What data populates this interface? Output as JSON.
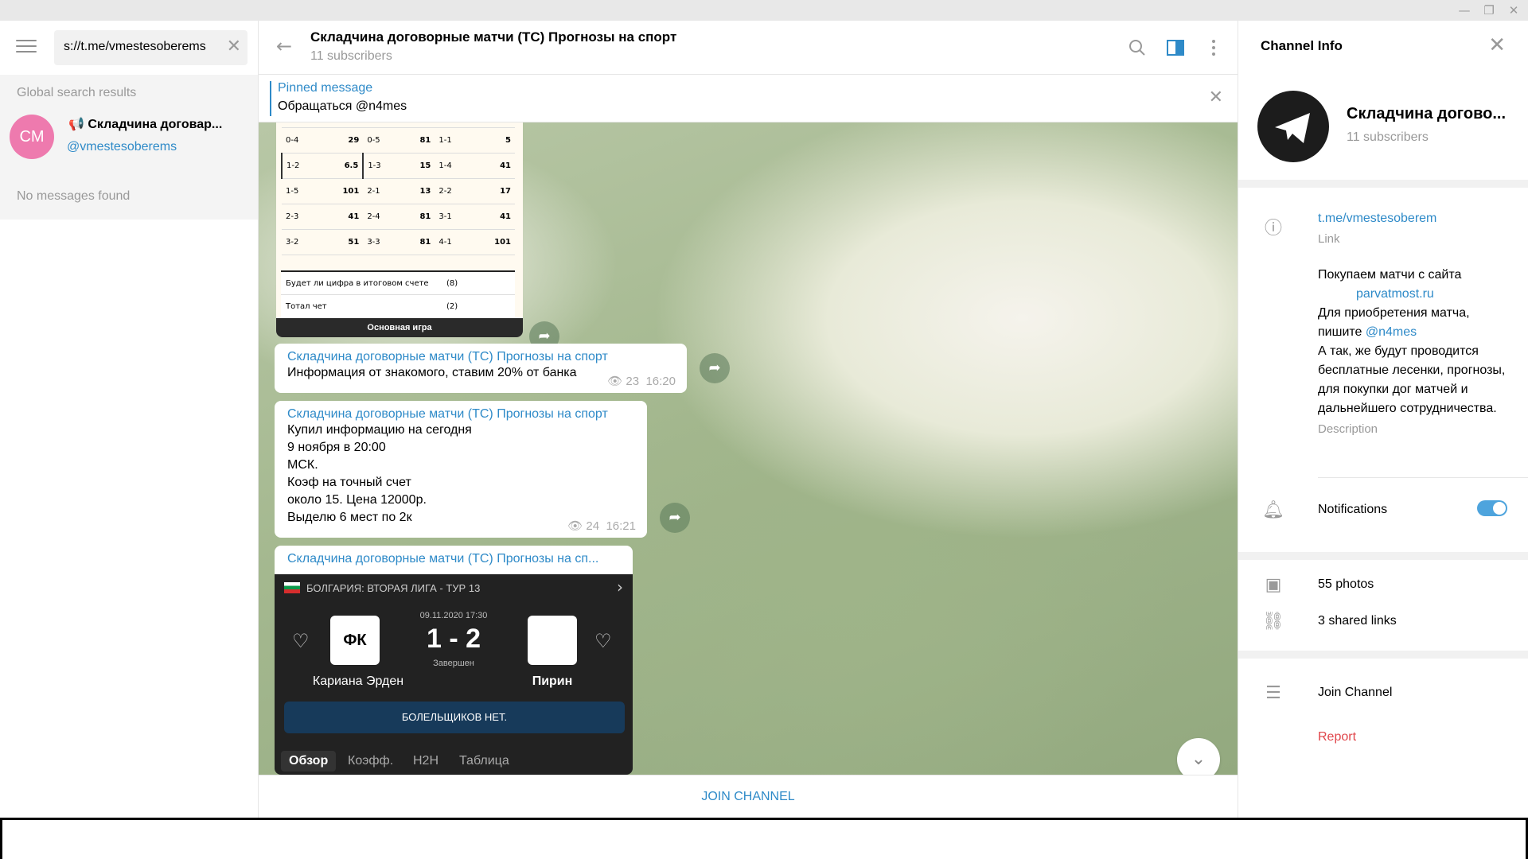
{
  "window": {
    "min": "—",
    "max": "❐",
    "close": "✕"
  },
  "left": {
    "search_value": "s://t.me/vmestesoberems",
    "global_search_header": "Global search results",
    "result": {
      "initials": "CM",
      "name": "📢 Складчина договар...",
      "handle": "@vmestesoberems"
    },
    "no_messages": "No messages found"
  },
  "chat": {
    "title": "Складчина договорные матчи (ТС) Прогнозы на спорт",
    "subscribers": "11 subscribers",
    "pinned_label": "Pinned message",
    "pinned_text": "Обращаться @n4mes",
    "join_label": "JOIN CHANNEL",
    "photo1": {
      "rows": [
        [
          "0-4",
          "29",
          "0-5",
          "81",
          "1-1",
          "5"
        ],
        [
          "1-2",
          "6.5",
          "1-3",
          "15",
          "1-4",
          "41"
        ],
        [
          "1-5",
          "101",
          "2-1",
          "13",
          "2-2",
          "17"
        ],
        [
          "2-3",
          "41",
          "2-4",
          "81",
          "3-1",
          "41"
        ],
        [
          "3-2",
          "51",
          "3-3",
          "81",
          "4-1",
          "101"
        ]
      ],
      "row_digit": "Будет ли цифра в итоговом счете",
      "row_digit_count": "(8)",
      "row_total": "Тотал чет",
      "row_total_count": "(2)",
      "footer": "Основная игра"
    },
    "messages": [
      {
        "author": "Складчина договорные матчи (ТС) Прогнозы на спорт",
        "text": "Информация от знакомого, ставим 20% от банка",
        "views": "23",
        "time": "16:20"
      },
      {
        "author": "Складчина договорные матчи (ТС) Прогнозы на спорт",
        "lines": [
          "Купил информацию на сегодня",
          "9 ноября в 20:00",
          "МСК.",
          "Коэф на точный счет",
          "около 15. Цена 12000р.",
          "Выделю 6 мест по 2к"
        ],
        "views": "24",
        "time": "16:21"
      },
      {
        "author": "Складчина договорные матчи (ТС) Прогнозы на сп..."
      }
    ],
    "match": {
      "league": "БОЛГАРИЯ: ВТОРАЯ ЛИГА - ТУР 13",
      "datetime": "09.11.2020 17:30",
      "score": "1 - 2",
      "status": "Завершен",
      "home": "Кариана Эрден",
      "away": "Пирин",
      "fans": "БОЛЕЛЬЩИКОВ НЕТ.",
      "tabs": [
        "Обзор",
        "Коэфф.",
        "H2H",
        "Таблица"
      ]
    }
  },
  "info": {
    "title": "Channel Info",
    "name": "Складчина догово...",
    "subscribers": "11 subscribers",
    "link": "t.me/vmestesoberem",
    "link_label": "Link",
    "desc_line1": "Покупаем матчи с сайта",
    "desc_site": "parvatmost.ru",
    "desc_line2": "Для приобретения матча, пишите",
    "desc_handle": "@n4mes",
    "desc_line3": "А так, же будут проводится бесплатные лесенки, прогнозы, для покупки дог матчей и дальнейшего сотрудничества.",
    "desc_label": "Description",
    "notifications": "Notifications",
    "notifications_on": true,
    "photos": "55 photos",
    "shared_links": "3 shared links",
    "join": "Join Channel",
    "report": "Report",
    "colors": {
      "accent": "#2e8ac8",
      "report": "#e0454a",
      "toggle": "#4ea4dd"
    }
  }
}
